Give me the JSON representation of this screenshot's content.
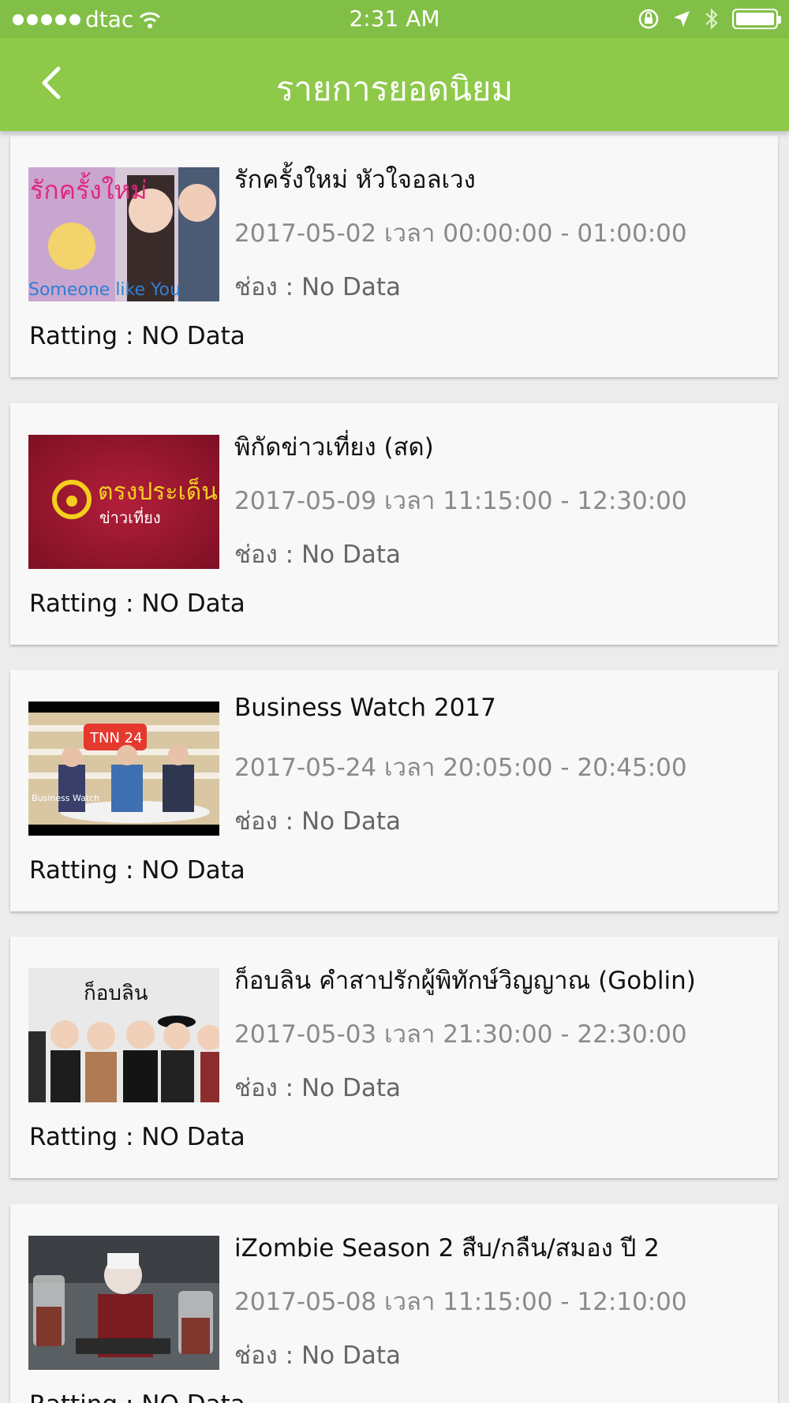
{
  "status_bar": {
    "carrier": "dtac",
    "time": "2:31 AM",
    "icons": [
      "signal-dots-icon",
      "wifi-icon",
      "rotation-lock-icon",
      "location-arrow-icon",
      "bluetooth-icon",
      "battery-icon"
    ]
  },
  "nav": {
    "title": "รายการยอดนิยม",
    "back_icon": "chevron-left-icon"
  },
  "colors": {
    "header_green": "#8ec94a",
    "status_green": "#82bf47",
    "background": "#ececec",
    "card": "#f8f8f8"
  },
  "programs": [
    {
      "title": "รักครั้งใหม่ หัวใจอลเวง",
      "datetime": "2017-05-02 เวลา 00:00:00 - 01:00:00",
      "channel": "ช่อง : No Data",
      "rating": "Ratting : NO Data",
      "thumb_text": "Someone like You"
    },
    {
      "title": "พิกัดข่าวเที่ยง (สด)",
      "datetime": "2017-05-09 เวลา 11:15:00 - 12:30:00",
      "channel": "ช่อง : No Data",
      "rating": "Ratting : NO Data",
      "thumb_text": "ตรงประเด็น",
      "thumb_subtext": "ข่าวเที่ยง"
    },
    {
      "title": "Business Watch 2017",
      "datetime": "2017-05-24 เวลา 20:05:00 - 20:45:00",
      "channel": "ช่อง : No Data",
      "rating": "Ratting : NO Data",
      "thumb_text": "TNN 24",
      "thumb_subtext": "Business Watch"
    },
    {
      "title": "ก็อบลิน คำสาปรักผู้พิทักษ์วิญญาณ (Goblin)",
      "datetime": "2017-05-03 เวลา 21:30:00 - 22:30:00",
      "channel": "ช่อง : No Data",
      "rating": "Ratting : NO Data",
      "thumb_text": "ก็อบลิน"
    },
    {
      "title": "iZombie Season 2 สืบ/กลืน/สมอง ปี 2",
      "datetime": "2017-05-08 เวลา 11:15:00 - 12:10:00",
      "channel": "ช่อง : No Data",
      "rating": "Ratting : NO Data"
    }
  ]
}
